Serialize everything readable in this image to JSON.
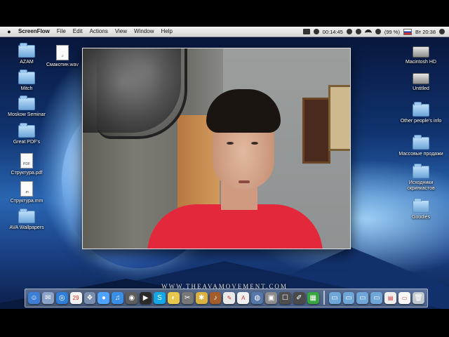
{
  "menubar": {
    "app_name": "ScreenFlow",
    "menus": [
      "File",
      "Edit",
      "Actions",
      "View",
      "Window",
      "Help"
    ],
    "status": {
      "time_recording": "00:14:45",
      "battery": "(99 %)",
      "day_time": "Вт 20:38"
    }
  },
  "desktop_left": [
    {
      "label": "AZAM",
      "type": "folder"
    },
    {
      "label": "Mitch",
      "type": "folder"
    },
    {
      "label": "Moskow Seminar",
      "type": "folder"
    },
    {
      "label": "Great PDF's",
      "type": "folder"
    },
    {
      "label": "Структура.pdf",
      "type": "pdf"
    },
    {
      "label": "Структура.mm",
      "type": "doc"
    },
    {
      "label": "AVA Wallpapers",
      "type": "folder"
    }
  ],
  "desktop_top": {
    "label": "Смакотин.wav",
    "type": "audio"
  },
  "desktop_right": [
    {
      "label": "Macintosh HD",
      "type": "disk"
    },
    {
      "label": "Untitled",
      "type": "disk"
    },
    {
      "label": "Other people's info",
      "type": "folder"
    },
    {
      "label": "Массовые продажи",
      "type": "folder"
    },
    {
      "label": "Исходники скринкастов",
      "type": "folder"
    },
    {
      "label": "Goodies",
      "type": "folder"
    }
  ],
  "watermark": "WWW.THEAVAMOVEMENT.COM",
  "dock": {
    "items": [
      {
        "name": "finder",
        "color": "#3d7fd6",
        "glyph": "☺"
      },
      {
        "name": "mail",
        "color": "#8aa3c7",
        "glyph": "✉"
      },
      {
        "name": "safari",
        "color": "#2f7fd9",
        "glyph": "◎"
      },
      {
        "name": "ical",
        "color": "#f2f2f2",
        "glyph": "29"
      },
      {
        "name": "preview",
        "color": "#7b8fb0",
        "glyph": "❖"
      },
      {
        "name": "ichat",
        "color": "#4ea3ff",
        "glyph": "●"
      },
      {
        "name": "itunes",
        "color": "#3a8ee6",
        "glyph": "♫"
      },
      {
        "name": "photo",
        "color": "#5d5d5d",
        "glyph": "◉"
      },
      {
        "name": "quicktime",
        "color": "#2a2a2a",
        "glyph": "▶"
      },
      {
        "name": "skype",
        "color": "#14a7e8",
        "glyph": "S"
      },
      {
        "name": "adium",
        "color": "#e7c84d",
        "glyph": "◐"
      },
      {
        "name": "scissors",
        "color": "#777",
        "glyph": "✂"
      },
      {
        "name": "pinwheel",
        "color": "#d9b140",
        "glyph": "✱"
      },
      {
        "name": "guitar",
        "color": "#a45c2a",
        "glyph": "♪"
      },
      {
        "name": "textedit",
        "color": "#e9e9e9",
        "glyph": "✎"
      },
      {
        "name": "appzapper",
        "color": "#f0f0f0",
        "glyph": "A"
      },
      {
        "name": "dvd",
        "color": "#5577aa",
        "glyph": "◍"
      },
      {
        "name": "screenflow",
        "color": "#8b8b8b",
        "glyph": "▣"
      },
      {
        "name": "utility",
        "color": "#4e4e4e",
        "glyph": "☐"
      },
      {
        "name": "pencil",
        "color": "#4a4a4a",
        "glyph": "✐"
      },
      {
        "name": "chart",
        "color": "#38a540",
        "glyph": "▦"
      }
    ],
    "right_items": [
      {
        "name": "folder-apps",
        "color": "#6fa6d8",
        "glyph": "▭"
      },
      {
        "name": "folder-docs",
        "color": "#6fa6d8",
        "glyph": "▭"
      },
      {
        "name": "folder-downloads",
        "color": "#6fa6d8",
        "glyph": "▭"
      },
      {
        "name": "folder-stack",
        "color": "#6fa6d8",
        "glyph": "▭"
      },
      {
        "name": "document-stack",
        "color": "#eeeeee",
        "glyph": "▤"
      },
      {
        "name": "stack-white",
        "color": "#f7f7f7",
        "glyph": "▭"
      },
      {
        "name": "trash",
        "color": "#bfc7cf",
        "glyph": "🗑"
      }
    ]
  }
}
